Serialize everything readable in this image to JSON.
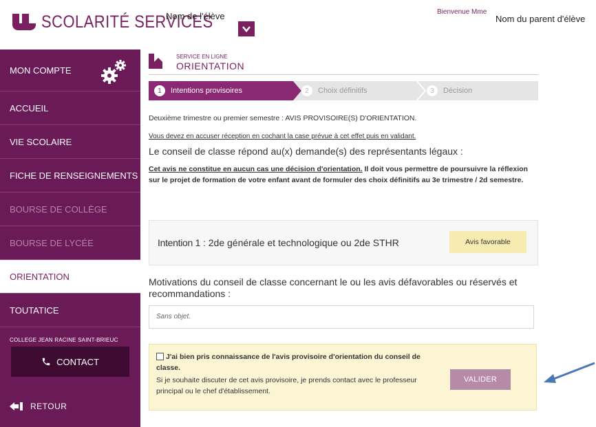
{
  "header": {
    "logo_text": "SCOLARITÉ SERVICES",
    "student_label": "Nom de l'élève",
    "welcome": "Bienvenue Mme",
    "parent_name": "Nom du parent d'élève"
  },
  "sidebar": {
    "items": [
      {
        "label": "MON COMPTE",
        "state": "normal"
      },
      {
        "label": "ACCUEIL",
        "state": "normal"
      },
      {
        "label": "VIE SCOLAIRE",
        "state": "normal"
      },
      {
        "label": "FICHE DE RENSEIGNEMENTS",
        "state": "normal"
      },
      {
        "label": "BOURSE DE COLLÈGE",
        "state": "disabled"
      },
      {
        "label": "BOURSE DE LYCÉE",
        "state": "disabled"
      },
      {
        "label": "ORIENTATION",
        "state": "active"
      },
      {
        "label": "TOUTATICE",
        "state": "normal"
      }
    ],
    "college": "COLLEGE JEAN RACINE SAINT-BRIEUC",
    "contact_label": "CONTACT",
    "back_label": "RETOUR"
  },
  "page": {
    "section_small": "SERVICE EN LIGNE",
    "title": "ORIENTATION"
  },
  "steps": [
    {
      "num": "1",
      "label": "Intentions provisoires",
      "active": true
    },
    {
      "num": "2",
      "label": "Choix définitifs",
      "active": false
    },
    {
      "num": "3",
      "label": "Décision",
      "active": false
    }
  ],
  "content": {
    "line1": "Deuxième trimestre ou premier semestre : AVIS PROVISOIRE(S) D'ORIENTATION.",
    "line2": "Vous devez en accuser réception en cochant la case prévue à cet effet puis en validant.",
    "line3": "Le conseil de classe répond au(x) demande(s) des représentants légaux :",
    "notice_underlined": "Cet avis ne constitue en aucun cas une décision d'orientation.",
    "notice_rest": " Il doit vous permettre de poursuivre la réflexion sur le projet de formation de votre enfant avant de formuler des choix définitifs au 3e trimestre / 2d semestre."
  },
  "intention": {
    "label": "Intention 1",
    "separator": " : ",
    "value": "2de générale et technologique ou 2de STHR",
    "status": "Avis favorable"
  },
  "motivations": {
    "label": "Motivations du conseil de classe concernant le ou les avis défavorables ou réservés et recommandations :",
    "value": "Sans objet."
  },
  "acknowledge": {
    "checkbox_label": "J'ai bien pris connaissance de l'avis provisoire d'orientation du conseil de classe.",
    "help": "Si je souhaite discuter de cet avis provisoire, je prends contact avec le professeur principal ou le chef d'établissement.",
    "validate_label": "VALIDER"
  },
  "colors": {
    "brand": "#7a1f5f",
    "sidebar_bg": "#6b1a58",
    "step_active": "#8a2873",
    "favorable_bg": "#f8ebb2",
    "annotation_arrow": "#4a78b5"
  }
}
